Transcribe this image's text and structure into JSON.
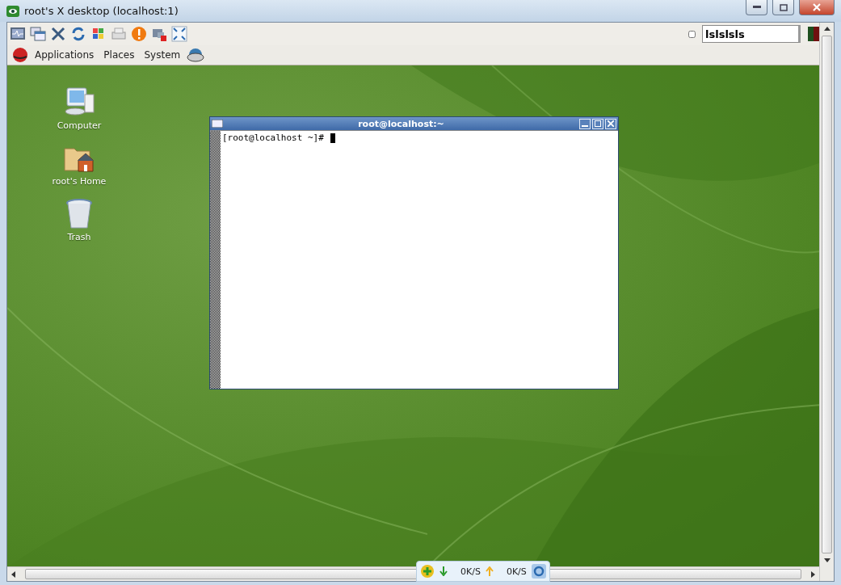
{
  "window": {
    "title": "root's X desktop (localhost:1)"
  },
  "panel": {
    "menus": [
      "Applications",
      "Places",
      "System"
    ],
    "field": {
      "value": "lslslsls"
    }
  },
  "desktop_icons": [
    {
      "kind": "computer",
      "label": "Computer"
    },
    {
      "kind": "home",
      "label": "root's Home"
    },
    {
      "kind": "trash",
      "label": "Trash"
    }
  ],
  "terminal": {
    "title": "root@localhost:~",
    "prompt": "[root@localhost ~]# "
  },
  "speed_widget": {
    "download": "0K/S",
    "upload": "0K/S"
  }
}
